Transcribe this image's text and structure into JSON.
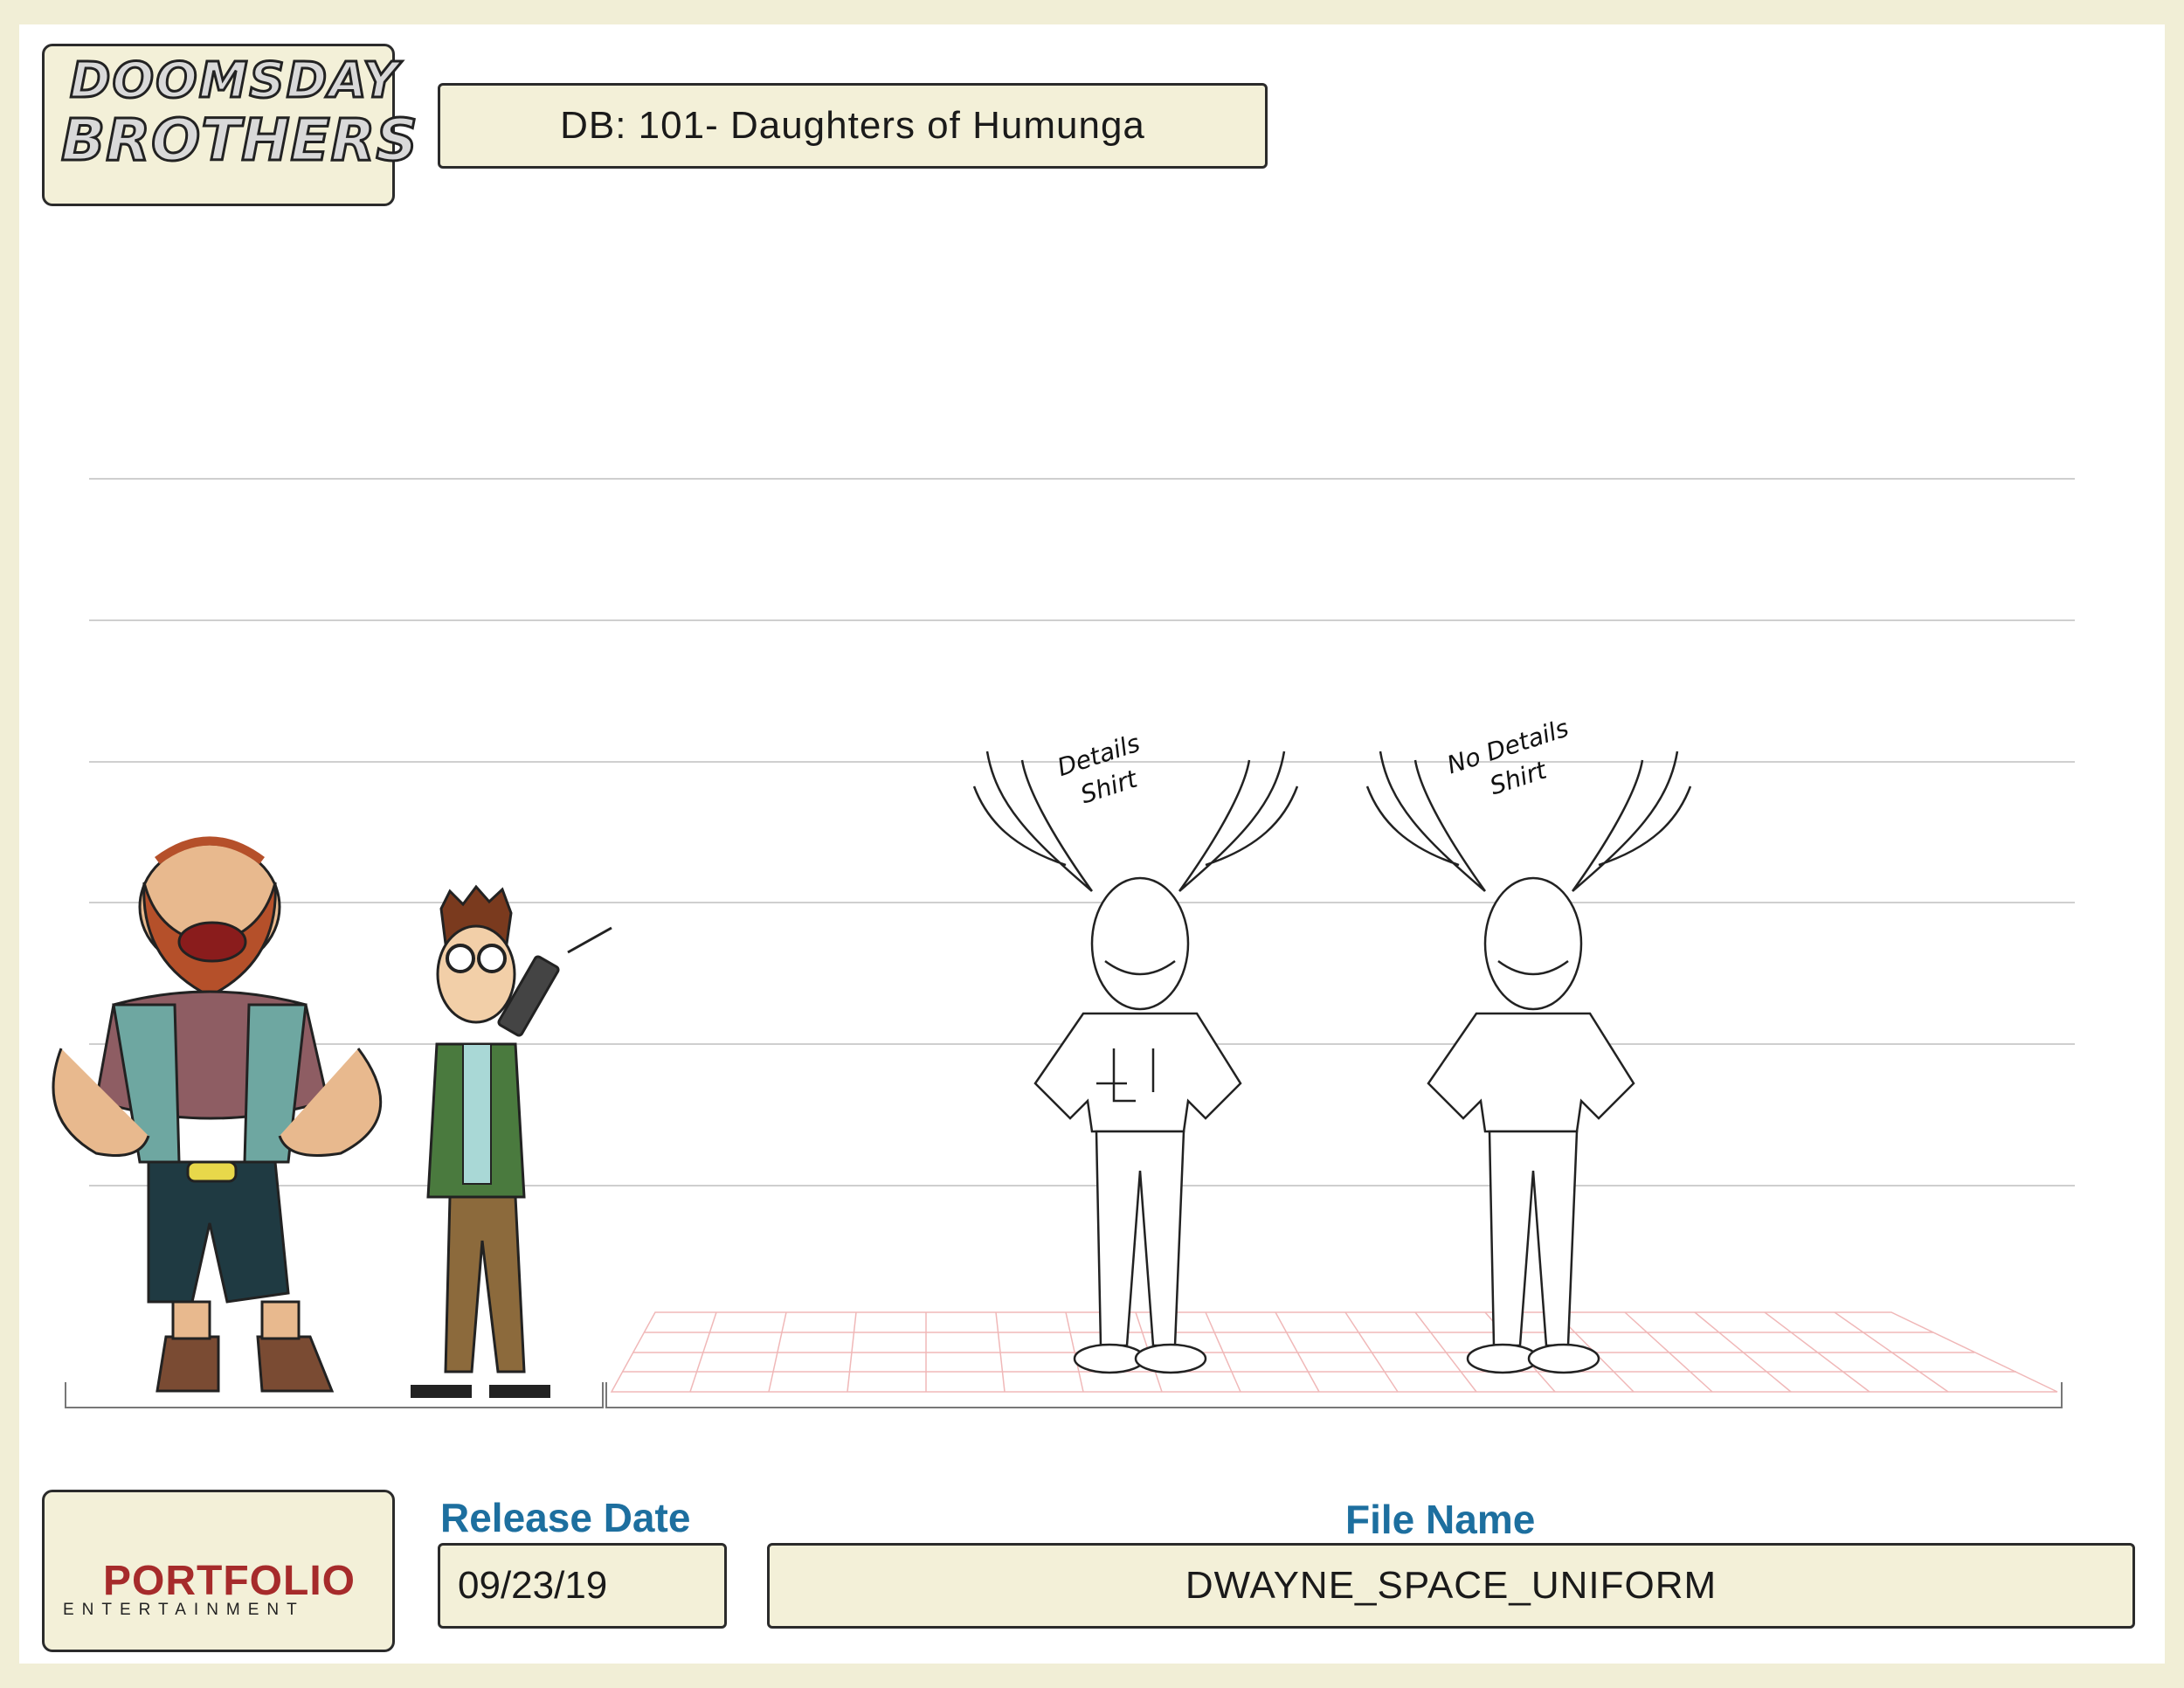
{
  "header": {
    "logo_line1": "DOOMSDAY",
    "logo_line2": "BROTHERS",
    "episode_title": "DB: 101- Daughters of Humunga"
  },
  "notes": {
    "left_line1": "Details",
    "left_line2": "Shirt",
    "right_line1": "No Details",
    "right_line2": "Shirt"
  },
  "footer": {
    "portfolio_word": "PORTFOLIO",
    "portfolio_sub": "ENTERTAINMENT",
    "release_label": "Release Date",
    "release_value": "09/23/19",
    "file_label": "File Name",
    "file_value": "DWAYNE_SPACE_UNIFORM"
  },
  "colors": {
    "background": "#f1eed6",
    "box_fill": "#f3f0d8",
    "label_blue": "#1d6f9f",
    "portfolio_red": "#a62b2b",
    "grid_red": "#f0b8b8"
  }
}
